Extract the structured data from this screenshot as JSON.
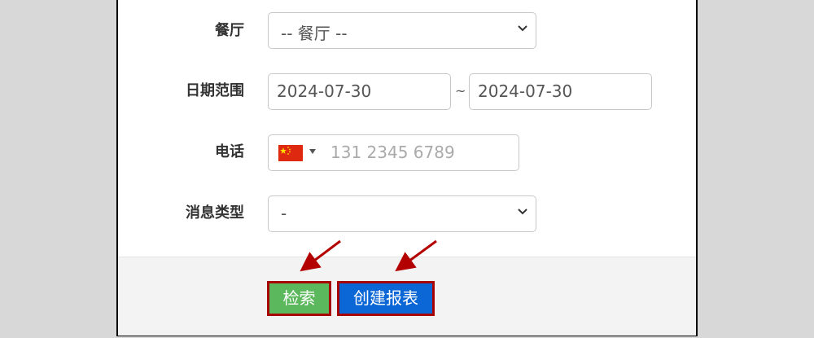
{
  "form": {
    "restaurant": {
      "label": "餐厅",
      "value": "-- 餐厅 --"
    },
    "date_range": {
      "label": "日期范围",
      "start": "2024-07-30",
      "separator": "~",
      "end": "2024-07-30"
    },
    "phone": {
      "label": "电话",
      "country_flag": "cn-flag-icon",
      "placeholder": "131 2345 6789"
    },
    "message_type": {
      "label": "消息类型",
      "value": "-"
    }
  },
  "actions": {
    "search_label": "检索",
    "create_report_label": "创建报表"
  },
  "colors": {
    "search_button": "#5cb85c",
    "create_report_button": "#0b67d6",
    "highlight_border": "#a80000",
    "annotation_arrow": "#b30000"
  }
}
